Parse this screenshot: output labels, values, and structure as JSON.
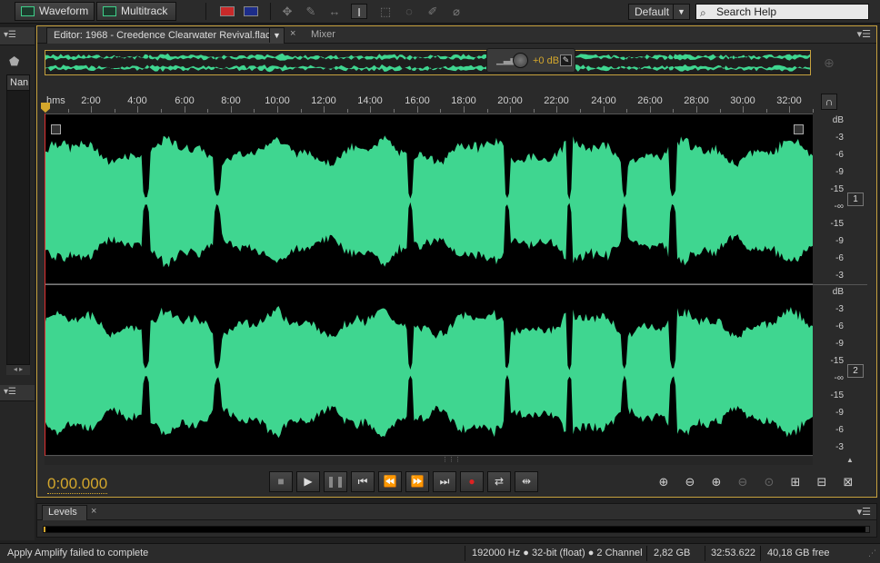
{
  "toolbar": {
    "waveform_label": "Waveform",
    "multitrack_label": "Multitrack",
    "workspace": "Default",
    "search_placeholder": "Search Help"
  },
  "left_panel": {
    "name_header": "Nan"
  },
  "editor": {
    "tab_label": "Editor: 1968 - Creedence Clearwater Revival.flac",
    "mixer_tab": "Mixer",
    "volume_hud": "+0 dB",
    "ruler_unit": "hms",
    "ruler_labels": [
      "2:00",
      "4:00",
      "6:00",
      "8:00",
      "10:00",
      "12:00",
      "14:00",
      "16:00",
      "18:00",
      "20:00",
      "22:00",
      "24:00",
      "26:00",
      "28:00",
      "30:00",
      "32:00"
    ],
    "db_labels": [
      "dB",
      "-3",
      "-6",
      "-9",
      "-15",
      "-∞",
      "-15",
      "-9",
      "-6",
      "-3"
    ],
    "channels": [
      "1",
      "2"
    ],
    "waveform_color": "#3fd690",
    "timecode": "0:00.000"
  },
  "levels": {
    "tab_label": "Levels"
  },
  "status": {
    "message": "Apply Amplify failed to complete",
    "format": "192000 Hz ● 32-bit (float) ● 2 Channel",
    "size": "2,82 GB",
    "duration": "32:53.622",
    "free": "40,18 GB free"
  }
}
